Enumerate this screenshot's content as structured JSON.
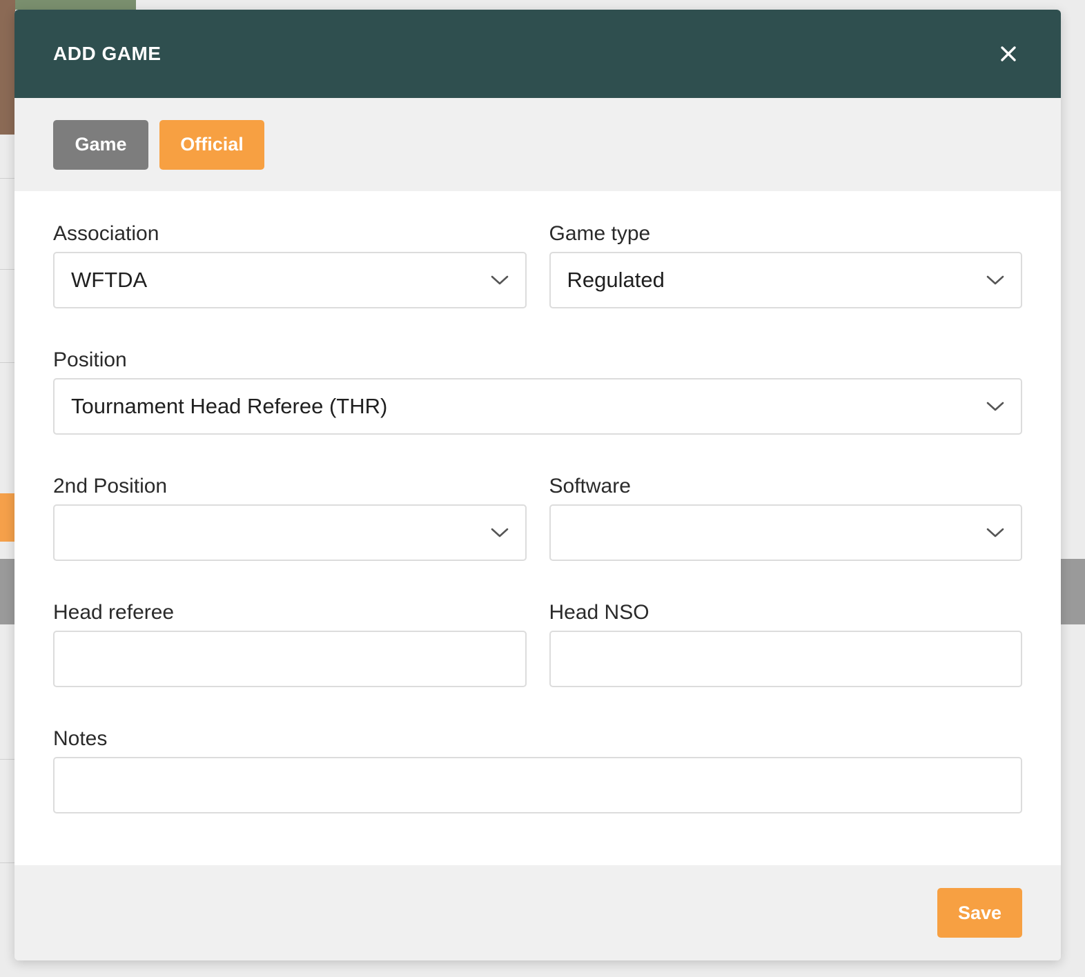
{
  "modal": {
    "title": "ADD GAME",
    "close_icon": "close-icon"
  },
  "tabs": [
    {
      "label": "Game",
      "color": "#7d7d7d",
      "active": false
    },
    {
      "label": "Official",
      "color": "#f7a042",
      "active": true
    }
  ],
  "form": {
    "association": {
      "label": "Association",
      "value": "WFTDA"
    },
    "game_type": {
      "label": "Game type",
      "value": "Regulated"
    },
    "position": {
      "label": "Position",
      "value": "Tournament Head Referee (THR)"
    },
    "second_position": {
      "label": "2nd Position",
      "value": ""
    },
    "software": {
      "label": "Software",
      "value": ""
    },
    "head_referee": {
      "label": "Head referee",
      "value": ""
    },
    "head_nso": {
      "label": "Head NSO",
      "value": ""
    },
    "notes": {
      "label": "Notes",
      "value": ""
    }
  },
  "footer": {
    "save_label": "Save"
  },
  "colors": {
    "header": "#2f4f4f",
    "accent": "#f7a042",
    "secondary_tab": "#7d7d7d"
  }
}
